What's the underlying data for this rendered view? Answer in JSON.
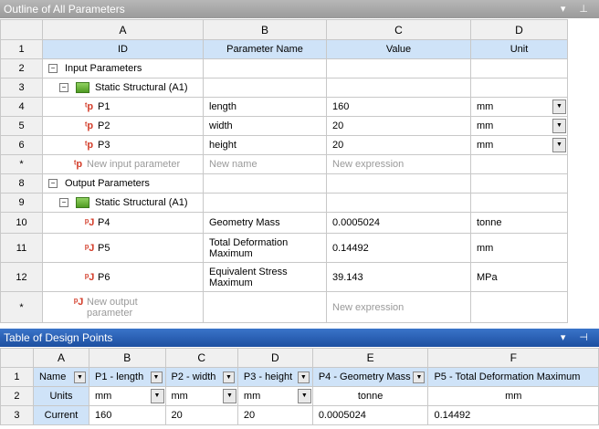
{
  "outline": {
    "title": "Outline of All Parameters",
    "controls": "▾ ⊥",
    "columns": [
      "A",
      "B",
      "C",
      "D"
    ],
    "header": {
      "id": "ID",
      "name": "Parameter Name",
      "value": "Value",
      "unit": "Unit"
    },
    "input_group": "Input Parameters",
    "input_system": "Static Structural (A1)",
    "inputs": [
      {
        "row": "4",
        "id": "P1",
        "name": "length",
        "value": "160",
        "unit": "mm"
      },
      {
        "row": "5",
        "id": "P2",
        "name": "width",
        "value": "20",
        "unit": "mm"
      },
      {
        "row": "6",
        "id": "P3",
        "name": "height",
        "value": "20",
        "unit": "mm"
      }
    ],
    "new_input": {
      "row": "*",
      "id": "New input parameter",
      "name": "New name",
      "value": "New expression"
    },
    "output_group": "Output Parameters",
    "output_system": "Static Structural (A1)",
    "outputs": [
      {
        "row": "10",
        "id": "P4",
        "name": "Geometry Mass",
        "value": "0.0005024",
        "unit": "tonne"
      },
      {
        "row": "11",
        "id": "P5",
        "name": "Total Deformation Maximum",
        "value": "0.14492",
        "unit": "mm"
      },
      {
        "row": "12",
        "id": "P6",
        "name": "Equivalent Stress Maximum",
        "value": "39.143",
        "unit": "MPa"
      }
    ],
    "new_output": {
      "row": "*",
      "id": "New output parameter",
      "value": "New expression"
    },
    "row_numbers": {
      "r1": "1",
      "r2": "2",
      "r3": "3",
      "r8": "8",
      "r9": "9"
    }
  },
  "design_points": {
    "title": "Table of Design Points",
    "controls": "▾ ⊣",
    "columns": [
      "A",
      "B",
      "C",
      "D",
      "E",
      "F"
    ],
    "headers": [
      "Name",
      "P1 - length",
      "P2 - width",
      "P3 - height",
      "P4 - Geometry Mass",
      "P5 - Total Deformation Maximum"
    ],
    "units_row": {
      "row": "2",
      "label": "Units",
      "p1": "mm",
      "p2": "mm",
      "p3": "mm",
      "p4": "tonne",
      "p5": "mm"
    },
    "current_row": {
      "row": "3",
      "label": "Current",
      "p1": "160",
      "p2": "20",
      "p3": "20",
      "p4": "0.0005024",
      "p5": "0.14492"
    },
    "header_row_num": "1"
  }
}
